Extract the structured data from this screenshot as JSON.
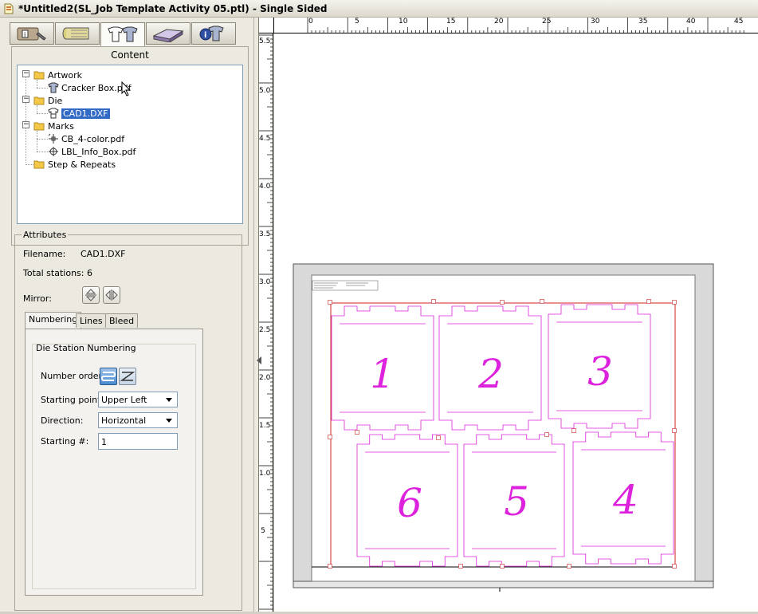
{
  "window": {
    "title": "*Untitled2(SL_Job Template Activity 05.ptl) - Single Sided"
  },
  "toolbar": {
    "tabs": [
      {
        "icon": "job-info-icon"
      },
      {
        "icon": "media-roll-icon"
      },
      {
        "icon": "content-shirts-icon"
      },
      {
        "icon": "press-sheet-icon"
      },
      {
        "icon": "info-shirt-icon"
      }
    ]
  },
  "content": {
    "label": "Content",
    "tree": [
      {
        "label": "Artwork",
        "children": [
          {
            "label": "Cracker Box.pdf",
            "icon": "shirt-icon"
          }
        ]
      },
      {
        "label": "Die",
        "children": [
          {
            "label": "CAD1.DXF",
            "icon": "die-shirt-icon",
            "selected": true
          }
        ]
      },
      {
        "label": "Marks",
        "children": [
          {
            "label": "CB_4-color.pdf",
            "icon": "color-bar-mark-icon"
          },
          {
            "label": "LBL_Info_Box.pdf",
            "icon": "crosshair-mark-icon"
          }
        ]
      },
      {
        "label": "Step & Repeats"
      }
    ]
  },
  "attributes": {
    "label": "Attributes",
    "filename_label": "Filename:",
    "filename_value": "CAD1.DXF",
    "stations_label": "Total stations:",
    "stations_value": "6",
    "mirror_label": "Mirror:",
    "subtabs": [
      "Numbering",
      "Lines",
      "Bleed"
    ],
    "numbering": {
      "group_title": "Die Station Numbering",
      "order_label": "Number order:",
      "start_label": "Starting point:",
      "start_value": "Upper Left",
      "direction_label": "Direction:",
      "direction_value": "Horizontal",
      "startnum_label": "Starting #:",
      "startnum_value": "1"
    }
  },
  "rulers": {
    "top_labels": [
      "0",
      "5",
      "10",
      "15",
      "20",
      "25",
      "30",
      "35",
      "40",
      "45"
    ],
    "left_labels": [
      "5.5",
      "5.0",
      "4.5",
      "4.0",
      "3.5",
      "3.0",
      "2.5",
      "2.0",
      "1.5",
      "1.0",
      "5"
    ]
  },
  "sheet": {
    "station_numbers": [
      "1",
      "2",
      "3",
      "6",
      "5",
      "4"
    ],
    "die_color": "#dd22dd",
    "bounds_color": "#cc2222"
  }
}
